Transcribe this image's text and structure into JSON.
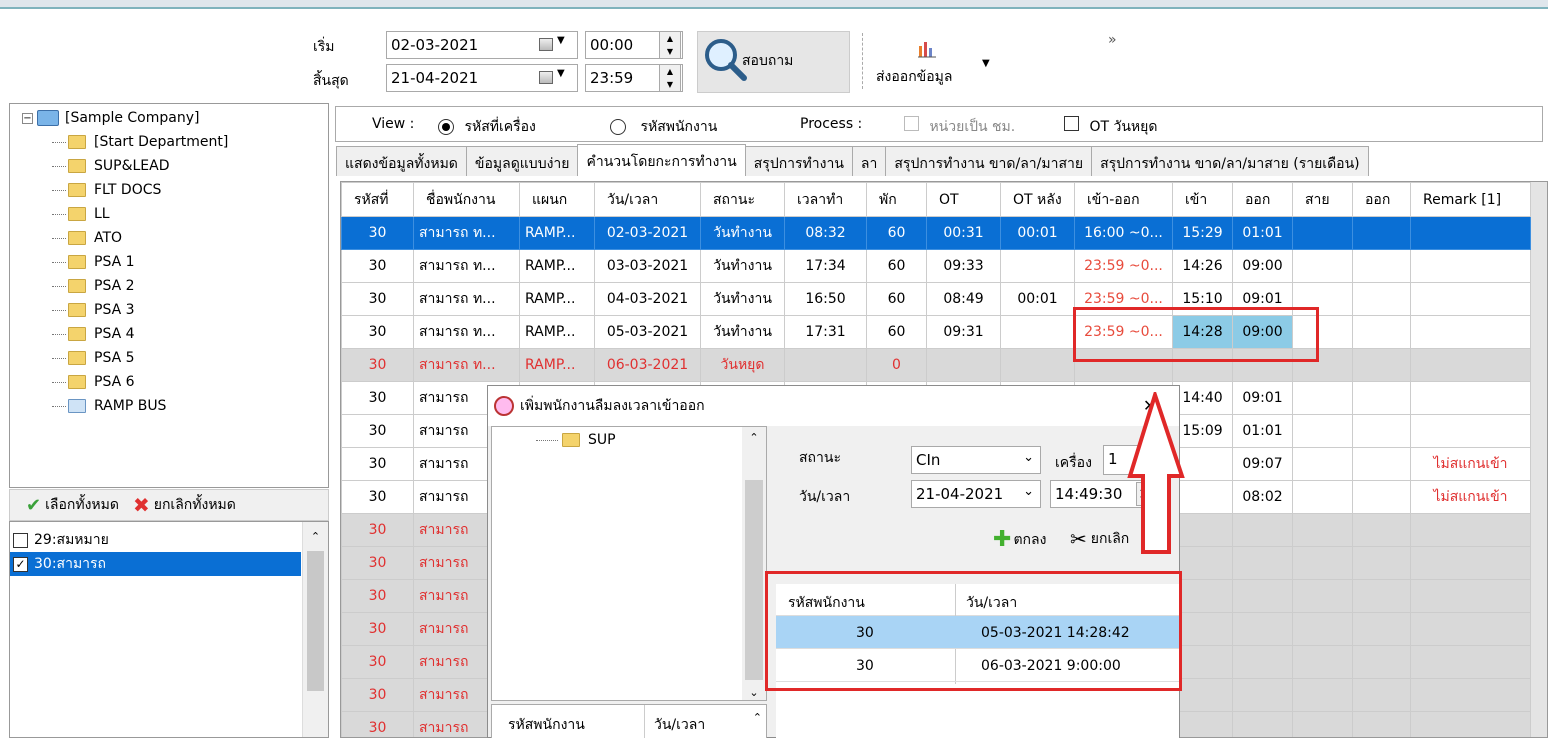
{
  "toolbar": {
    "start_label": "เริ่ม",
    "end_label": "สิ้นสุด",
    "start_date": "02-03-2021",
    "start_time": "00:00",
    "end_date": "21-04-2021",
    "end_time": "23:59",
    "query_label": "สอบถาม",
    "export_label": "ส่งออกข้อมูล",
    "overflow": "»"
  },
  "tree": {
    "root": "[Sample Company]",
    "items": [
      "[Start Department]",
      "SUP&LEAD",
      "FLT DOCS",
      "LL",
      "ATO",
      "PSA 1",
      "PSA 2",
      "PSA 3",
      "PSA 4",
      "PSA 5",
      "PSA 6",
      "RAMP BUS"
    ]
  },
  "select_bar": {
    "select_all": "เลือกทั้งหมด",
    "deselect_all": "ยกเลิกทั้งหมด"
  },
  "employees": [
    {
      "label": "29:สมหมาย",
      "checked": false
    },
    {
      "label": "30:สามารถ",
      "checked": true
    }
  ],
  "view": {
    "label": "View :",
    "option_machine": "รหัสที่เครื่อง",
    "option_employee": "รหัสพนักงาน",
    "process_label": "Process :",
    "unit_hours": "หน่วยเป็น ชม.",
    "ot_holiday": "OT วันหยุด"
  },
  "tabs": [
    "แสดงข้อมูลทั้งหมด",
    "ข้อมูลดูแบบง่าย",
    "คำนวนโดยกะการทำงาน",
    "สรุปการทำงาน",
    "ลา",
    "สรุปการทำงาน ขาด/ลา/มาสาย",
    "สรุปการทำงาน ขาด/ลา/มาสาย (รายเดือน)"
  ],
  "grid": {
    "headers": [
      "รหัสที่",
      "ชื่อพนักงาน",
      "แผนก",
      "วัน/เวลา",
      "สถานะ",
      "เวลาทำ",
      "พัก",
      "OT",
      "OT หลัง",
      "เข้า-ออก",
      "เข้า",
      "ออก",
      "สาย",
      "ออก",
      "Remark [1]"
    ],
    "rows": [
      {
        "style": "sel",
        "cells": [
          "30",
          "สามารถ ท...",
          "RAMP...",
          "02-03-2021",
          "วันทำงาน",
          "08:32",
          "60",
          "00:31",
          "00:01",
          "16:00 ~0...",
          "15:29",
          "01:01",
          "",
          "",
          ""
        ]
      },
      {
        "style": "",
        "cells": [
          "30",
          "สามารถ ท...",
          "RAMP...",
          "03-03-2021",
          "วันทำงาน",
          "17:34",
          "60",
          "09:33",
          "",
          "23:59 ~0...",
          "14:26",
          "09:00",
          "",
          "",
          ""
        ]
      },
      {
        "style": "",
        "cells": [
          "30",
          "สามารถ ท...",
          "RAMP...",
          "04-03-2021",
          "วันทำงาน",
          "16:50",
          "60",
          "08:49",
          "00:01",
          "23:59 ~0...",
          "15:10",
          "09:01",
          "",
          "",
          ""
        ]
      },
      {
        "style": "",
        "cells": [
          "30",
          "สามารถ ท...",
          "RAMP...",
          "05-03-2021",
          "วันทำงาน",
          "17:31",
          "60",
          "09:31",
          "",
          "23:59 ~0...",
          "14:28",
          "09:00",
          "",
          "",
          ""
        ]
      },
      {
        "style": "holiday",
        "cells": [
          "30",
          "สามารถ ท...",
          "RAMP...",
          "06-03-2021",
          "วันหยุด",
          "",
          "0",
          "",
          "",
          "",
          "",
          "",
          "",
          "",
          ""
        ]
      },
      {
        "style": "",
        "cells": [
          "30",
          "สามารถ",
          "",
          "",
          "",
          "",
          "",
          "",
          "",
          "",
          "14:40",
          "09:01",
          "",
          "",
          ""
        ]
      },
      {
        "style": "",
        "cells": [
          "30",
          "สามารถ",
          "",
          "",
          "",
          "",
          "",
          "",
          "",
          "",
          "15:09",
          "01:01",
          "",
          "",
          ""
        ]
      },
      {
        "style": "",
        "cells": [
          "30",
          "สามารถ",
          "",
          "",
          "",
          "",
          "",
          "",
          "",
          "",
          "",
          "09:07",
          "",
          "",
          "ไม่สแกนเข้า"
        ]
      },
      {
        "style": "",
        "cells": [
          "30",
          "สามารถ",
          "",
          "",
          "",
          "",
          "",
          "",
          "",
          "",
          "",
          "08:02",
          "",
          "",
          "ไม่สแกนเข้า"
        ]
      },
      {
        "style": "holiday",
        "cells": [
          "30",
          "สามารถ",
          "",
          "",
          "",
          "",
          "",
          "",
          "",
          "",
          "",
          "",
          "",
          "",
          ""
        ]
      },
      {
        "style": "holiday",
        "cells": [
          "30",
          "สามารถ",
          "",
          "",
          "",
          "",
          "",
          "",
          "",
          "",
          "",
          "",
          "",
          "",
          ""
        ]
      },
      {
        "style": "holiday",
        "cells": [
          "30",
          "สามารถ",
          "",
          "",
          "",
          "",
          "",
          "",
          "",
          "",
          "",
          "",
          "",
          "",
          ""
        ]
      },
      {
        "style": "holiday",
        "cells": [
          "30",
          "สามารถ",
          "",
          "",
          "",
          "",
          "",
          "",
          "",
          "",
          "",
          "",
          "",
          "",
          ""
        ]
      },
      {
        "style": "holiday",
        "cells": [
          "30",
          "สามารถ",
          "",
          "",
          "",
          "",
          "",
          "",
          "",
          "",
          "",
          "",
          "",
          "",
          ""
        ]
      },
      {
        "style": "holiday",
        "cells": [
          "30",
          "สามารถ",
          "",
          "",
          "",
          "",
          "",
          "",
          "",
          "",
          "",
          "",
          "",
          "",
          ""
        ]
      },
      {
        "style": "holiday",
        "cells": [
          "30",
          "สามารถ",
          "",
          "",
          "",
          "",
          "",
          "",
          "",
          "",
          "",
          "",
          "",
          "",
          ""
        ]
      }
    ]
  },
  "dialog": {
    "title": "เพิ่มพนักงานลืมลงเวลาเข้าออก",
    "close": "✕",
    "tree_item": "SUP",
    "status_label": "สถานะ",
    "status_value": "CIn",
    "machine_label": "เครื่อง",
    "machine_value": "1",
    "datetime_label": "วัน/เวลา",
    "date_value": "21-04-2021",
    "time_value": "14:49:30",
    "ok_label": "ตกลง",
    "cancel_label": "ยกเลิก",
    "list_headers": [
      "รหัสพนักงาน",
      "วัน/เวลา"
    ],
    "list_rows": [
      {
        "id": "30",
        "datetime": "05-03-2021 14:28:42"
      },
      {
        "id": "30",
        "datetime": "06-03-2021 9:00:00"
      }
    ],
    "bottom_headers": [
      "รหัสพนักงาน",
      "วัน/เวลา"
    ]
  }
}
